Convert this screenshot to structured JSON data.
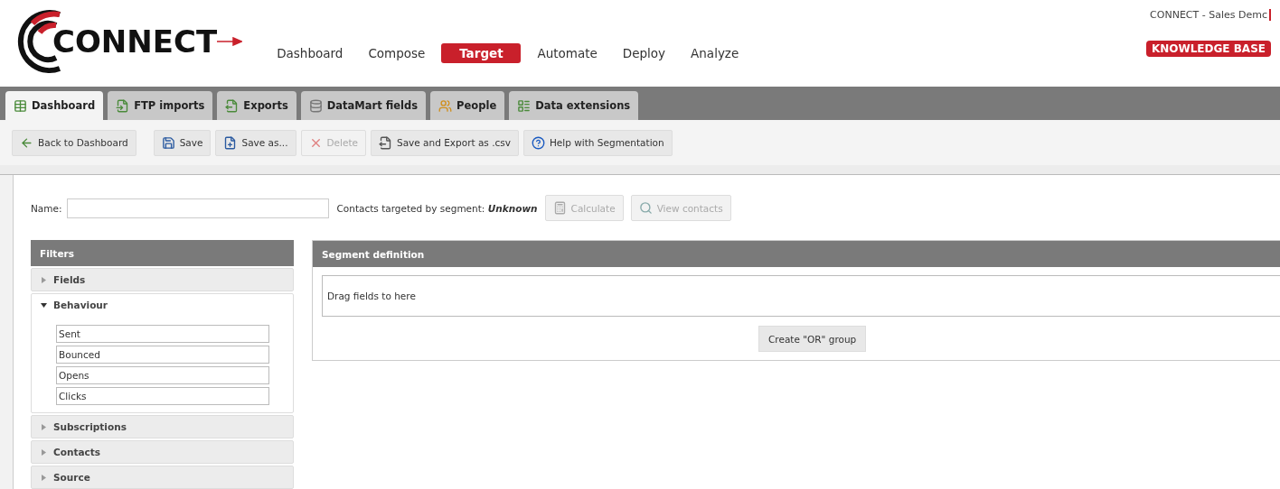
{
  "logo": {
    "text": "CONNECT"
  },
  "nav": [
    {
      "label": "Dashboard",
      "selected": false
    },
    {
      "label": "Compose",
      "selected": false
    },
    {
      "label": "Target",
      "selected": true
    },
    {
      "label": "Automate",
      "selected": false
    },
    {
      "label": "Deploy",
      "selected": false
    },
    {
      "label": "Analyze",
      "selected": false
    }
  ],
  "account": {
    "label": "CONNECT - Sales Demc"
  },
  "knowledge_base": {
    "label": "KNOWLEDGE BASE"
  },
  "tabs": [
    {
      "label": "Dashboard",
      "selected": true
    },
    {
      "label": "FTP imports",
      "selected": false
    },
    {
      "label": "Exports",
      "selected": false
    },
    {
      "label": "DataMart fields",
      "selected": false
    },
    {
      "label": "People",
      "selected": false
    },
    {
      "label": "Data extensions",
      "selected": false
    }
  ],
  "toolbar": [
    {
      "label": "Back to Dashboard",
      "disabled": false
    },
    {
      "label": "Save",
      "disabled": false
    },
    {
      "label": "Save as...",
      "disabled": false
    },
    {
      "label": "Delete",
      "disabled": true
    },
    {
      "label": "Save and Export as .csv",
      "disabled": false
    },
    {
      "label": "Help with Segmentation",
      "disabled": false
    }
  ],
  "name_field": {
    "label": "Name:"
  },
  "contacts_targeted": {
    "label": "Contacts targeted by segment:",
    "value": "Unknown"
  },
  "segment_actions": [
    {
      "label": "Calculate",
      "disabled": true
    },
    {
      "label": "View contacts",
      "disabled": true
    }
  ],
  "filters": {
    "title": "Filters",
    "sections": [
      {
        "label": "Fields",
        "expanded": false
      },
      {
        "label": "Behaviour",
        "expanded": true,
        "items": [
          "Sent",
          "Bounced",
          "Opens",
          "Clicks"
        ]
      },
      {
        "label": "Subscriptions",
        "expanded": false
      },
      {
        "label": "Contacts",
        "expanded": false
      },
      {
        "label": "Source",
        "expanded": false
      }
    ]
  },
  "segment": {
    "title": "Segment definition",
    "drop_hint": "Drag fields to here",
    "or_button": "Create \"OR\" group"
  }
}
